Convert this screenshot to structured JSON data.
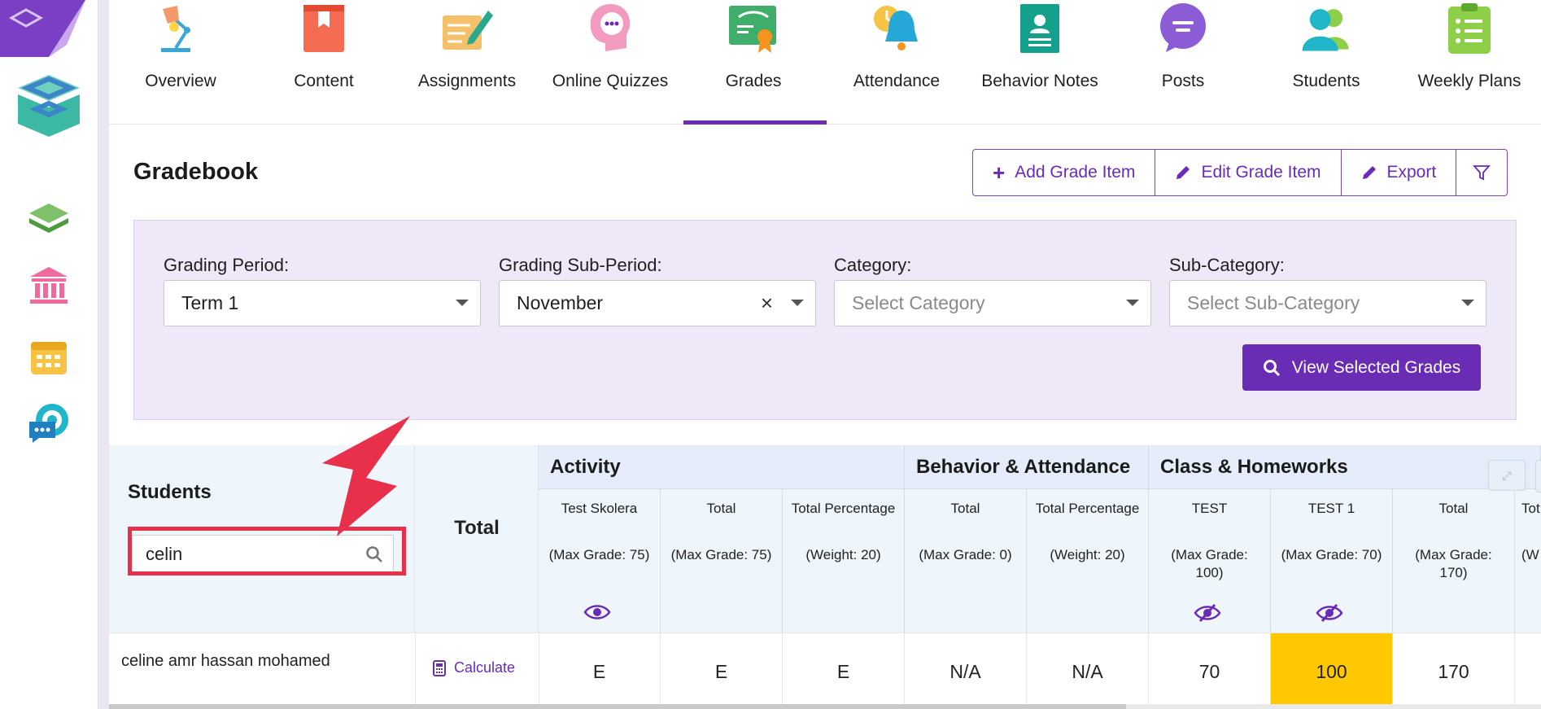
{
  "nav": {
    "items": [
      {
        "label": "Overview",
        "icon": "desk-lamp-icon"
      },
      {
        "label": "Content",
        "icon": "book-icon"
      },
      {
        "label": "Assignments",
        "icon": "pen-paper-icon"
      },
      {
        "label": "Online Quizzes",
        "icon": "head-chat-icon"
      },
      {
        "label": "Grades",
        "icon": "certificate-icon"
      },
      {
        "label": "Attendance",
        "icon": "alarm-bell-icon"
      },
      {
        "label": "Behavior Notes",
        "icon": "notebook-icon"
      },
      {
        "label": "Posts",
        "icon": "speech-bubble-icon"
      },
      {
        "label": "Students",
        "icon": "users-icon"
      },
      {
        "label": "Weekly Plans",
        "icon": "clipboard-list-icon"
      }
    ],
    "active": "Grades"
  },
  "gradebook": {
    "title": "Gradebook",
    "buttons": {
      "add": "Add Grade Item",
      "edit": "Edit Grade Item",
      "export": "Export"
    }
  },
  "filters": {
    "grading_period_label": "Grading Period:",
    "grading_period_value": "Term 1",
    "sub_period_label": "Grading Sub-Period:",
    "sub_period_value": "November",
    "category_label": "Category:",
    "category_placeholder": "Select Category",
    "sub_category_label": "Sub-Category:",
    "sub_category_placeholder": "Select Sub-Category",
    "view_button": "View Selected Grades"
  },
  "table": {
    "students_header": "Students",
    "search_value": "celin",
    "total_header": "Total",
    "groups": [
      {
        "name": "Activity"
      },
      {
        "name": "Behavior & Attendance"
      },
      {
        "name": "Class & Homeworks"
      }
    ],
    "columns": [
      {
        "name": "Test Skolera",
        "meta": "(Max Grade: 75)",
        "visibility": "visible"
      },
      {
        "name": "Total",
        "meta": "(Max Grade: 75)",
        "visibility": ""
      },
      {
        "name": "Total Percentage",
        "meta": "(Weight: 20)",
        "visibility": ""
      },
      {
        "name": "Total",
        "meta": "(Max Grade: 0)",
        "visibility": ""
      },
      {
        "name": "Total Percentage",
        "meta": "(Weight: 20)",
        "visibility": ""
      },
      {
        "name": "TEST",
        "meta": "(Max Grade: 100)",
        "visibility": "hidden"
      },
      {
        "name": "TEST 1",
        "meta": "(Max Grade: 70)",
        "visibility": "hidden"
      },
      {
        "name": "Total",
        "meta": "(Max Grade: 170)",
        "visibility": ""
      },
      {
        "name": "Tot",
        "meta": "(W",
        "visibility": ""
      }
    ],
    "rows": [
      {
        "student": "celine amr hassan mohamed",
        "total_action": "Calculate",
        "cells": [
          "E",
          "E",
          "E",
          "N/A",
          "N/A",
          "70",
          "100",
          "170",
          ""
        ]
      }
    ]
  },
  "colors": {
    "accent": "#6a2bb5",
    "highlight_cell": "#ffc800",
    "annotation": "#e8304a"
  }
}
